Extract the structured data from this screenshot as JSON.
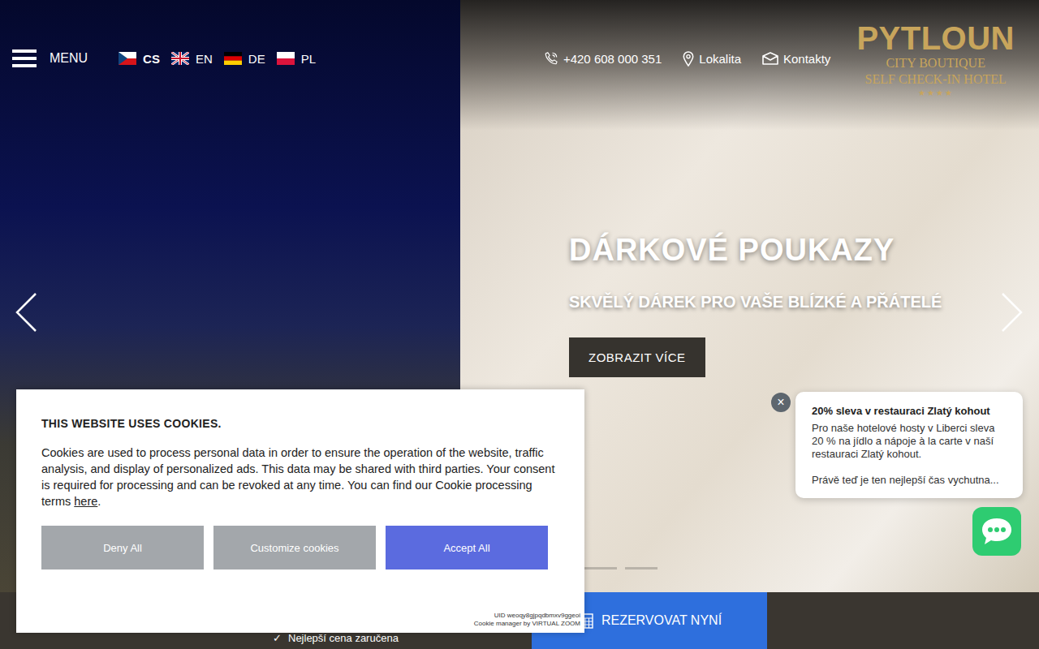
{
  "header": {
    "menu_label": "MENU",
    "languages": [
      {
        "label": "CS",
        "selected": true,
        "kind": "cz"
      },
      {
        "label": "EN",
        "selected": false,
        "kind": "gb"
      },
      {
        "label": "DE",
        "selected": false,
        "kind": "de"
      },
      {
        "label": "PL",
        "selected": false,
        "kind": "pl"
      }
    ],
    "contacts": [
      {
        "label": "+420 608 000 351",
        "kind": "phone"
      },
      {
        "label": "Lokalita",
        "kind": "pin"
      },
      {
        "label": "Kontakty",
        "kind": "mail"
      }
    ]
  },
  "logo": {
    "name": "PYTLOUN",
    "line1": "CITY BOUTIQUE",
    "line2": "SELF CHECK-IN HOTEL",
    "stars": "★★★★"
  },
  "slide": {
    "title": "DÁRKOVÉ POUKAZY",
    "subtitle": "SKVĚLÝ DÁREK PRO VAŠE BLÍZKÉ A PŘÁTELÉ",
    "button": "ZOBRAZIT VÍCE"
  },
  "slider_dots": [
    {
      "selected": true
    },
    {
      "selected": false
    },
    {
      "selected": false
    },
    {
      "selected": false
    },
    {
      "selected": false
    }
  ],
  "bottom_bar": {
    "check": "✓",
    "feature": "Nejlepší cena zaručena",
    "reserve": "REZERVOVAT NYNÍ"
  },
  "cookie_banner": {
    "title": "THIS WEBSITE USES COOKIES.",
    "text": "Cookies are used to process personal data in order to ensure the operation of the website, traffic analysis, and display of personalized ads. This data may be shared with third parties. Your consent is required for processing and can be revoked at any time. You can find our Cookie processing terms ",
    "link": "here",
    "after": ".",
    "buttons": [
      {
        "label": "Deny All",
        "kind": "secondary"
      },
      {
        "label": "Customize cookies",
        "kind": "secondary"
      },
      {
        "label": "Accept All",
        "kind": "primary"
      }
    ],
    "uid": "UID weoqy8gjpqdbmxv9ggeoi",
    "credit": "Cookie manager by VIRTUAL ZOOM"
  },
  "promo": {
    "close": "×",
    "title": "20% sleva v restauraci Zlatý kohout",
    "text": "Pro naše hotelové hosty v Liberci sleva 20 % na jídlo a nápoje à la carte v naší restauraci Zlatý kohout.",
    "more": "Právě teď je ten nejlepší čas vychutna..."
  }
}
